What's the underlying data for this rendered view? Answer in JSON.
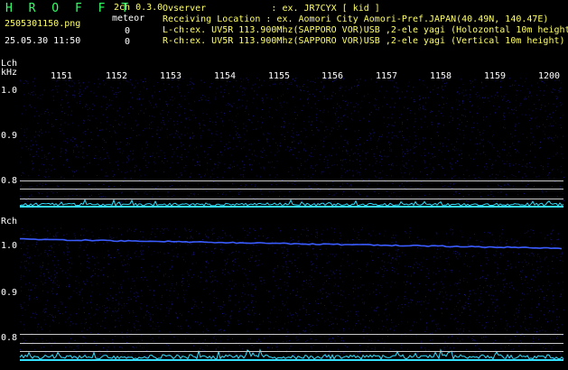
{
  "header": {
    "app_name": "H R O F F T",
    "mode": "2ch 0.3.0",
    "filename": "2505301150.png",
    "meteor_label": "meteor",
    "datetime": "25.05.30 11:50",
    "lch_count": "0",
    "rch_count": "0",
    "observer": "Ovserver            : ex. JR7CYX [ kid ]",
    "location": "Receiving Location : ex. Aomori City Aomori-Pref.JAPAN(40.49N, 140.47E)",
    "lch_info": "L-ch:ex. UV5R 113.900Mhz(SAPPORO VOR)USB ,2-ele yagi (Holozontal 10m height)",
    "rch_info": "R-ch:ex. UV5R 113.900Mhz(SAPPORO VOR)USB ,2-ele yagi (Vertical 10m height)"
  },
  "lch": {
    "label": "Lch",
    "unit": "kHz",
    "y_ticks": [
      "1.0",
      "0.9",
      "0.8"
    ]
  },
  "rch": {
    "label": "Rch",
    "y_ticks": [
      "1.0",
      "0.9",
      "0.8"
    ]
  },
  "time_axis": [
    "1151",
    "1152",
    "1153",
    "1154",
    "1155",
    "1156",
    "1157",
    "1158",
    "1159",
    "1200"
  ],
  "colors": {
    "background": "#000000",
    "noise": "#1a1aa0",
    "signal": "#3a5cff",
    "level": "#33e0ff",
    "header_yellow": "#ffff66",
    "header_green": "#33ff66"
  }
}
